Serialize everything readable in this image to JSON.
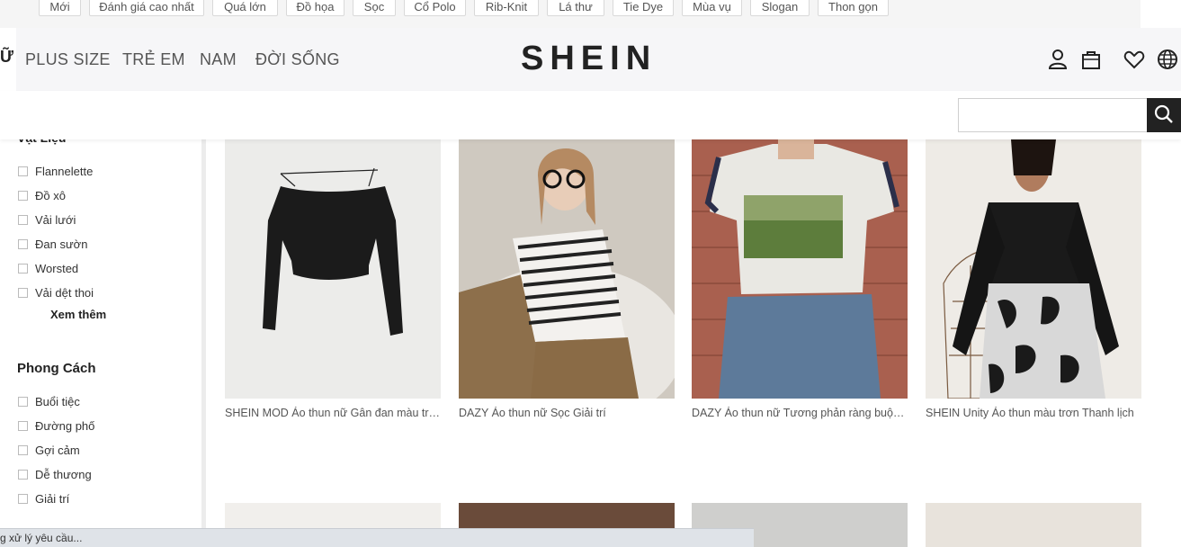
{
  "tags": [
    "Mới",
    "Đánh giá cao nhất",
    "Quá lớn",
    "Đồ họa",
    "Sọc",
    "Cổ Polo",
    "Rib-Knit",
    "Lá thư",
    "Tie Dye",
    "Mùa vụ",
    "Slogan",
    "Thon gọn"
  ],
  "nav": {
    "cut_item": "Ữ",
    "items": [
      "PLUS SIZE",
      "TRẺ EM",
      "NAM",
      "ĐỜI SỐNG"
    ]
  },
  "brand": {
    "logo": "SHEIN"
  },
  "header_icons": [
    "user-icon",
    "bag-icon",
    "heart-icon",
    "globe-icon"
  ],
  "search": {
    "value": "",
    "placeholder": ""
  },
  "sidebar": {
    "material": {
      "title": "Vật Liệu",
      "options": [
        "Flannelette",
        "Đồ xô",
        "Vải lưới",
        "Đan sườn",
        "Worsted",
        "Vải dệt thoi"
      ],
      "see_more": "Xem thêm"
    },
    "style": {
      "title": "Phong Cách",
      "options": [
        "Buổi tiệc",
        "Đường phố",
        "Gợi cảm",
        "Dễ thương",
        "Giải trí"
      ]
    }
  },
  "products": [
    {
      "name": "SHEIN MOD Áo thun nữ Gân đan màu trơn Trang nhã"
    },
    {
      "name": "DAZY Áo thun nữ Sọc Giải trí"
    },
    {
      "name": "DAZY Áo thun nữ Tương phản ràng buộc Vintage"
    },
    {
      "name": "SHEIN Unity Áo thun màu trơn Thanh lịch"
    }
  ],
  "status_bar": "g xử lý yêu cầu..."
}
